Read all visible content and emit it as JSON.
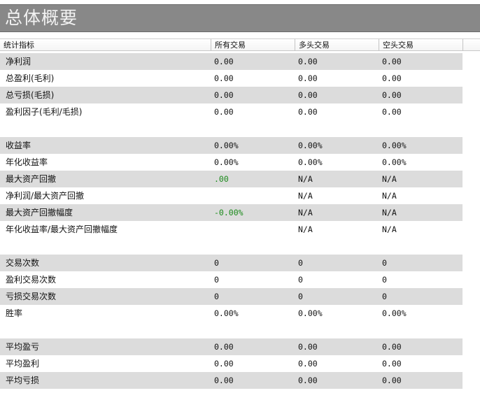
{
  "header": {
    "title": "总体概要"
  },
  "columns": {
    "metric": "统计指标",
    "all": "所有交易",
    "long": "多头交易",
    "short": "空头交易"
  },
  "rows": [
    {
      "label": "净利润",
      "all": "0.00",
      "long": "0.00",
      "short": "0.00"
    },
    {
      "label": "总盈利(毛利)",
      "all": "0.00",
      "long": "0.00",
      "short": "0.00"
    },
    {
      "label": "总亏损(毛损)",
      "all": "0.00",
      "long": "0.00",
      "short": "0.00"
    },
    {
      "label": "盈利因子(毛利/毛损)",
      "all": "0.00",
      "long": "0.00",
      "short": "0.00"
    },
    {
      "label": "收益率",
      "all": "0.00%",
      "long": "0.00%",
      "short": "0.00%"
    },
    {
      "label": "年化收益率",
      "all": "0.00%",
      "long": "0.00%",
      "short": "0.00%"
    },
    {
      "label": "最大资产回撤",
      "all": ".00",
      "long": "N/A",
      "short": "N/A"
    },
    {
      "label": "净利润/最大资产回撤",
      "all": "",
      "long": "N/A",
      "short": "N/A"
    },
    {
      "label": "最大资产回撤幅度",
      "all": "-0.00%",
      "long": "N/A",
      "short": "N/A"
    },
    {
      "label": "年化收益率/最大资产回撤幅度",
      "all": "",
      "long": "N/A",
      "short": "N/A"
    },
    {
      "label": "交易次数",
      "all": "0",
      "long": "0",
      "short": "0"
    },
    {
      "label": "盈利交易次数",
      "all": "0",
      "long": "0",
      "short": "0"
    },
    {
      "label": "亏损交易次数",
      "all": "0",
      "long": "0",
      "short": "0"
    },
    {
      "label": "胜率",
      "all": "0.00%",
      "long": "0.00%",
      "short": "0.00%"
    },
    {
      "label": "平均盈亏",
      "all": "0.00",
      "long": "0.00",
      "short": "0.00"
    },
    {
      "label": "平均盈利",
      "all": "0.00",
      "long": "0.00",
      "short": "0.00"
    },
    {
      "label": "平均亏损",
      "all": "0.00",
      "long": "0.00",
      "short": "0.00"
    }
  ],
  "colors": {
    "drawdown_value": "#1a8a1a"
  }
}
